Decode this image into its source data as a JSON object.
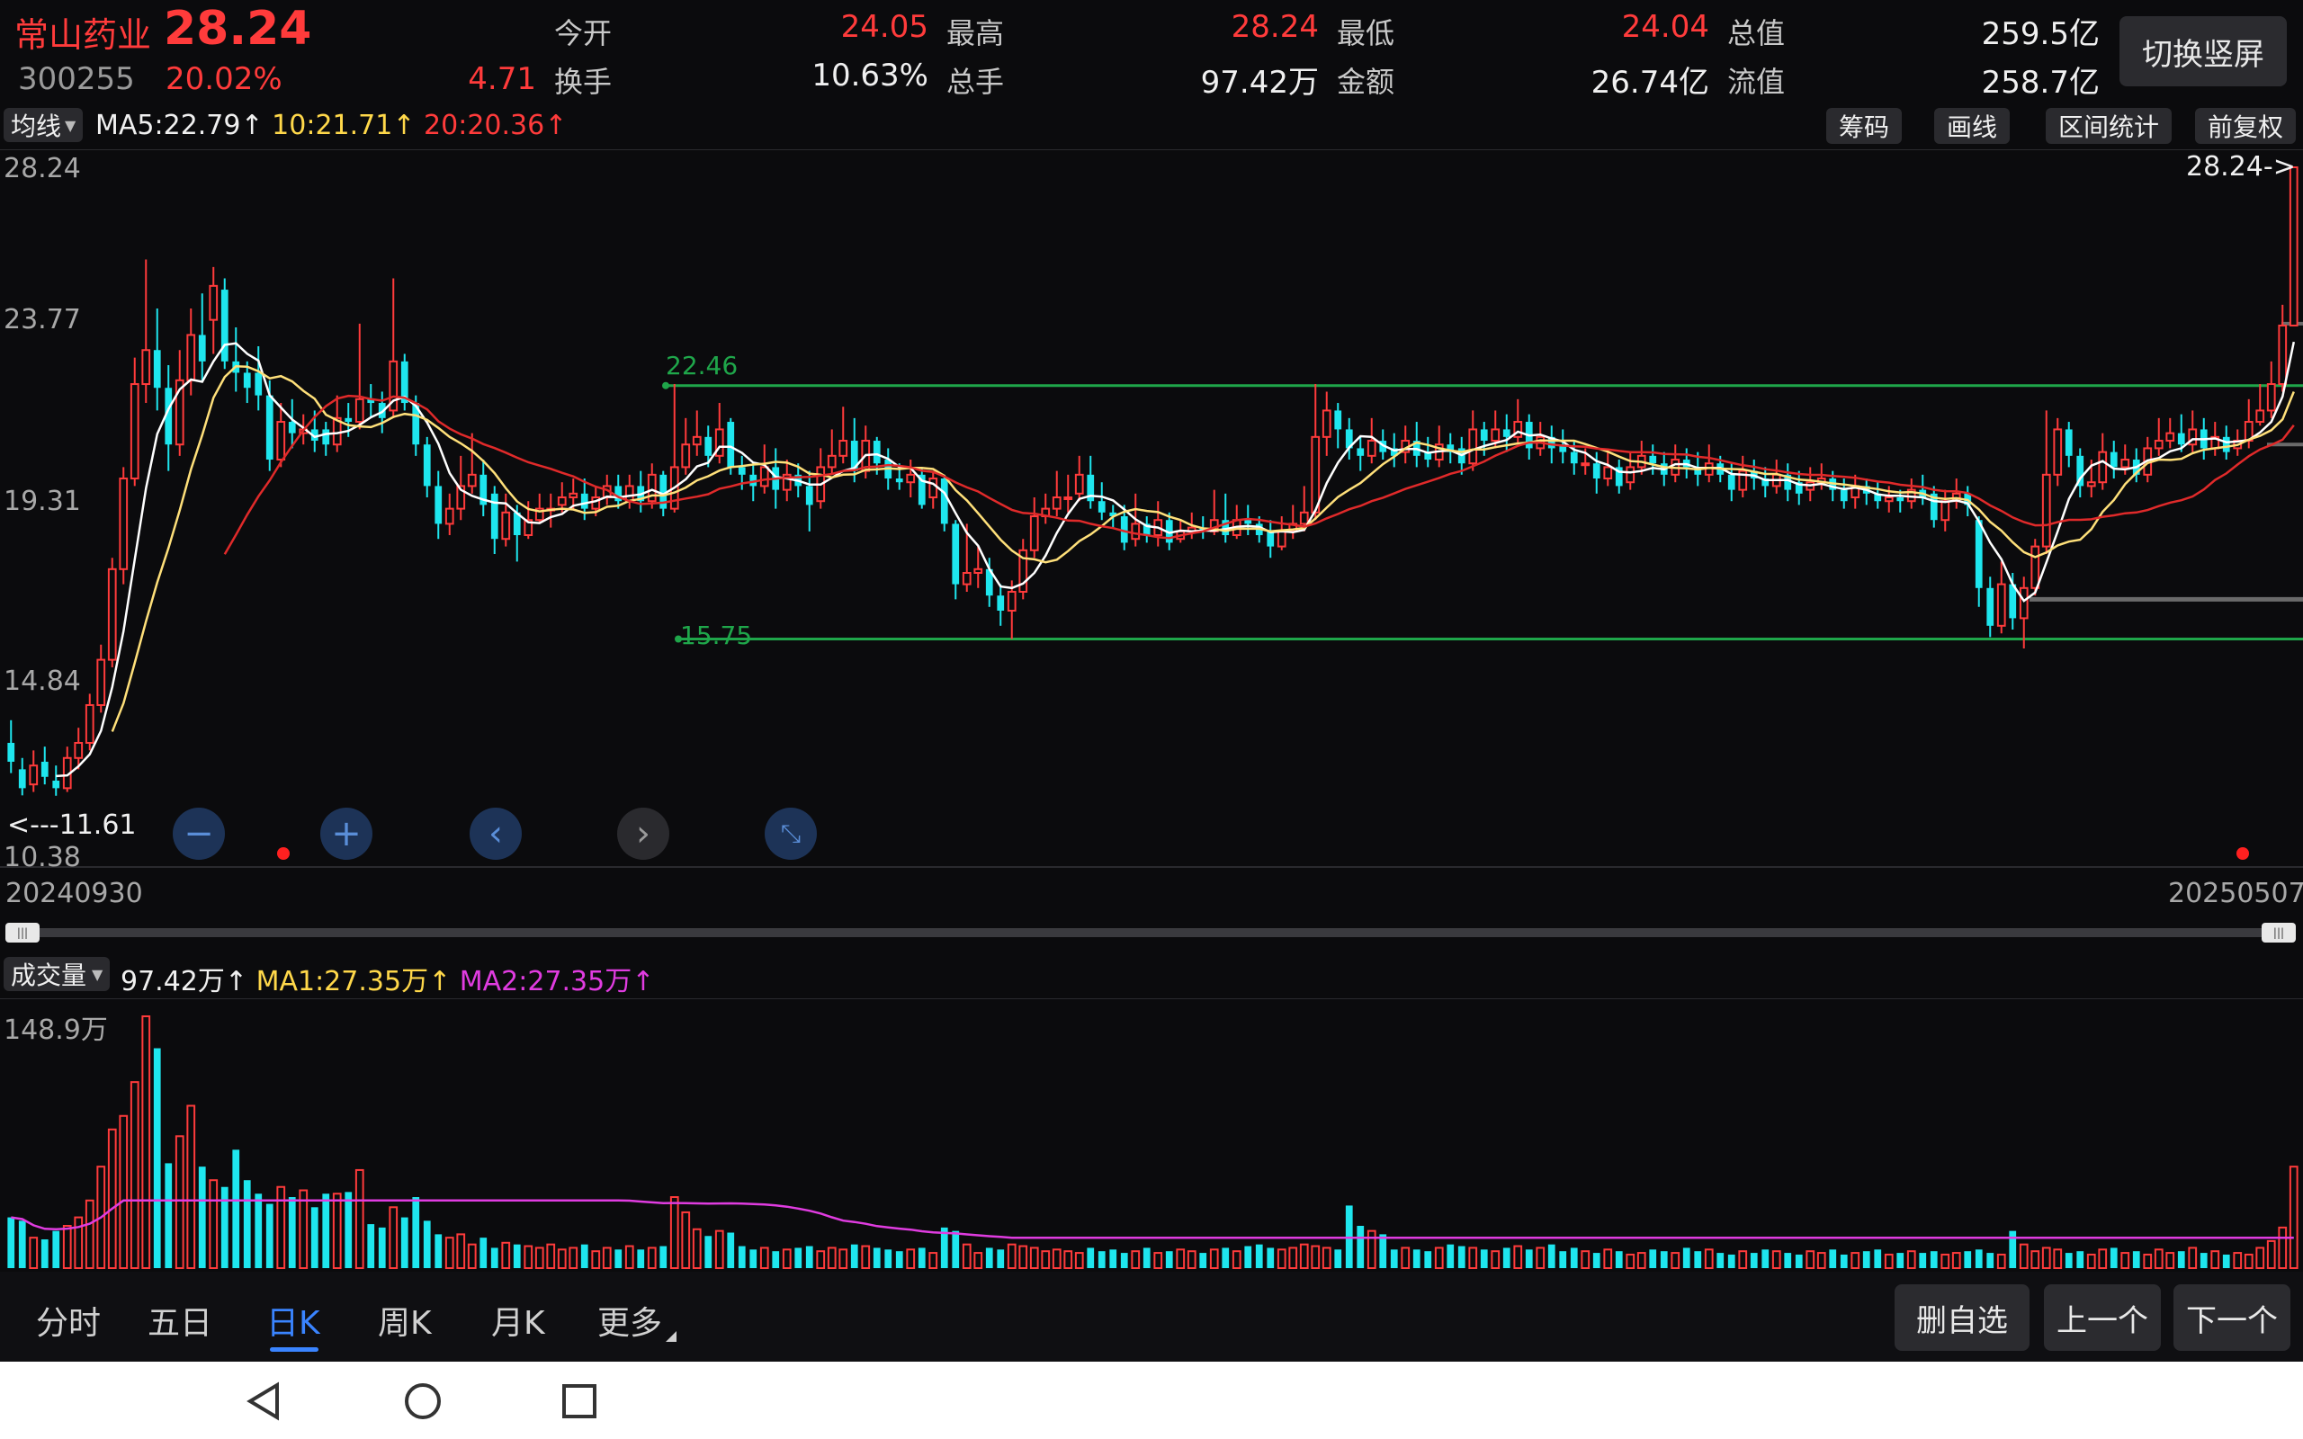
{
  "stock": {
    "name": "常山药业",
    "code": "300255",
    "price": "28.24",
    "change_pct": "20.02%",
    "change_abs": "4.71"
  },
  "quote": {
    "open_label": "今开",
    "open": "24.05",
    "high_label": "最高",
    "high": "28.24",
    "low_label": "最低",
    "low": "24.04",
    "mcap_label": "总值",
    "mcap": "259.5亿",
    "turnover_label": "换手",
    "turnover": "10.63%",
    "vol_label": "总手",
    "vol": "97.42万",
    "amount_label": "金额",
    "amount": "26.74亿",
    "float_label": "流值",
    "float": "258.7亿"
  },
  "switch_button": "切换竖屏",
  "ma_bar": {
    "selector": "均线",
    "ma5": "MA5:22.79",
    "ma10": "10:21.71",
    "ma20": "20:20.36",
    "arrow": "↑"
  },
  "tools": [
    "筹码",
    "画线",
    "区间统计",
    "前复权"
  ],
  "price_axis": {
    "max_label": "28.24",
    "l1": "23.77",
    "l2": "19.31",
    "l3": "14.84",
    "min_label": "10.38",
    "right_marker": "28.24->",
    "left_marker": "<---11.61"
  },
  "lines": {
    "upper": "22.46",
    "lower": "15.75"
  },
  "dates": {
    "start": "20240930",
    "end": "20250507"
  },
  "volume_bar": {
    "selector": "成交量",
    "vol": "97.42万",
    "ma1": "MA1:27.35万",
    "ma2": "MA2:27.35万",
    "arrow": "↑",
    "max_label": "148.9万"
  },
  "tabs": [
    "分时",
    "五日",
    "日K",
    "周K",
    "月K",
    "更多"
  ],
  "active_tab": "日K",
  "actions": [
    "删自选",
    "上一个",
    "下一个"
  ],
  "colors": {
    "up": "#ff3b3b",
    "down": "#1ee6ee",
    "ma5": "#ffffff",
    "ma10": "#ffe07a",
    "ma20": "#e02a2a",
    "hline": "#1fa64a",
    "vol_ma2": "#e03ce0",
    "accent": "#3a84ff"
  },
  "chart_data": {
    "type": "candlestick",
    "ylim": [
      10.38,
      28.24
    ],
    "candles": [
      [
        13.0,
        12.5,
        13.6,
        12.2
      ],
      [
        12.3,
        11.8,
        12.6,
        11.61
      ],
      [
        11.9,
        12.4,
        12.8,
        11.7
      ],
      [
        12.5,
        12.1,
        12.9,
        11.9
      ],
      [
        12.0,
        11.8,
        12.4,
        11.6
      ],
      [
        11.8,
        12.6,
        12.9,
        11.7
      ],
      [
        12.6,
        13.0,
        13.4,
        12.3
      ],
      [
        13.0,
        14.0,
        14.3,
        12.8
      ],
      [
        14.0,
        15.2,
        15.6,
        13.8
      ],
      [
        15.2,
        17.6,
        17.9,
        15.0
      ],
      [
        17.6,
        20.0,
        20.3,
        17.2
      ],
      [
        20.0,
        22.5,
        23.2,
        19.8
      ],
      [
        22.5,
        23.4,
        25.8,
        22.0
      ],
      [
        23.4,
        22.4,
        24.5,
        21.8
      ],
      [
        22.4,
        20.9,
        23.0,
        20.2
      ],
      [
        20.9,
        22.6,
        23.4,
        20.6
      ],
      [
        22.6,
        23.8,
        24.5,
        22.2
      ],
      [
        23.8,
        23.1,
        24.9,
        22.6
      ],
      [
        24.2,
        25.1,
        25.6,
        23.3
      ],
      [
        25.0,
        23.1,
        25.3,
        22.9
      ],
      [
        23.1,
        22.8,
        24.0,
        22.3
      ],
      [
        22.8,
        22.4,
        23.1,
        22.0
      ],
      [
        22.8,
        22.2,
        23.5,
        21.8
      ],
      [
        22.2,
        20.5,
        22.6,
        20.2
      ],
      [
        20.5,
        21.5,
        22.0,
        20.3
      ],
      [
        21.5,
        21.2,
        22.1,
        20.8
      ],
      [
        21.2,
        21.3,
        21.7,
        20.9
      ],
      [
        21.3,
        21.0,
        21.8,
        20.7
      ],
      [
        21.3,
        20.9,
        21.5,
        20.6
      ],
      [
        20.9,
        21.6,
        22.2,
        20.7
      ],
      [
        21.6,
        21.5,
        22.0,
        21.1
      ],
      [
        21.5,
        22.1,
        24.1,
        21.3
      ],
      [
        22.1,
        22.0,
        22.5,
        21.6
      ],
      [
        22.0,
        21.6,
        22.3,
        21.2
      ],
      [
        21.8,
        23.1,
        25.3,
        21.6
      ],
      [
        23.1,
        22.0,
        23.3,
        21.8
      ],
      [
        22.0,
        20.9,
        22.2,
        20.6
      ],
      [
        20.9,
        19.8,
        21.1,
        19.5
      ],
      [
        19.8,
        18.8,
        20.2,
        18.4
      ],
      [
        18.8,
        19.2,
        19.6,
        18.5
      ],
      [
        19.2,
        19.8,
        20.6,
        18.9
      ],
      [
        19.8,
        20.1,
        21.2,
        19.6
      ],
      [
        20.1,
        19.3,
        20.5,
        19.0
      ],
      [
        19.6,
        18.4,
        19.8,
        18.0
      ],
      [
        18.4,
        19.1,
        19.6,
        18.2
      ],
      [
        19.1,
        18.5,
        19.3,
        17.8
      ],
      [
        18.5,
        18.9,
        19.4,
        18.4
      ],
      [
        18.9,
        19.2,
        19.6,
        18.8
      ],
      [
        19.2,
        19.2,
        19.6,
        18.7
      ],
      [
        19.3,
        19.5,
        19.9,
        19.1
      ],
      [
        19.5,
        19.6,
        20.0,
        19.2
      ],
      [
        19.6,
        19.2,
        20.0,
        18.9
      ],
      [
        19.2,
        19.5,
        19.8,
        19.0
      ],
      [
        19.5,
        19.8,
        20.1,
        19.3
      ],
      [
        19.8,
        19.4,
        20.1,
        19.2
      ],
      [
        19.4,
        19.8,
        20.1,
        19.2
      ],
      [
        19.8,
        19.4,
        20.2,
        19.1
      ],
      [
        19.4,
        20.1,
        20.4,
        19.2
      ],
      [
        20.1,
        19.2,
        20.2,
        19.0
      ],
      [
        19.2,
        20.3,
        22.5,
        19.1
      ],
      [
        20.3,
        20.9,
        21.6,
        20.1
      ],
      [
        20.9,
        21.1,
        21.8,
        20.6
      ],
      [
        21.1,
        20.6,
        21.4,
        20.3
      ],
      [
        20.6,
        21.3,
        22.0,
        20.4
      ],
      [
        21.5,
        20.3,
        21.6,
        20.1
      ],
      [
        20.3,
        20.1,
        20.6,
        19.7
      ],
      [
        20.1,
        19.8,
        20.4,
        19.4
      ],
      [
        19.8,
        20.3,
        20.9,
        19.6
      ],
      [
        20.3,
        19.7,
        20.8,
        19.2
      ],
      [
        19.7,
        20.1,
        20.5,
        19.4
      ],
      [
        20.1,
        19.8,
        20.4,
        19.5
      ],
      [
        19.8,
        19.3,
        20.2,
        18.6
      ],
      [
        19.4,
        20.3,
        20.8,
        19.2
      ],
      [
        20.3,
        20.6,
        21.3,
        20.1
      ],
      [
        20.6,
        21.0,
        21.9,
        20.4
      ],
      [
        21.0,
        20.2,
        21.6,
        19.9
      ],
      [
        20.2,
        21.0,
        21.4,
        20.0
      ],
      [
        21.0,
        20.4,
        21.1,
        20.1
      ],
      [
        20.5,
        20.0,
        20.8,
        19.7
      ],
      [
        20.0,
        19.9,
        20.4,
        19.7
      ],
      [
        19.9,
        20.1,
        20.5,
        19.5
      ],
      [
        20.1,
        19.3,
        20.3,
        19.2
      ],
      [
        19.5,
        20.0,
        20.2,
        19.2
      ],
      [
        20.0,
        18.8,
        20.1,
        18.6
      ],
      [
        18.8,
        17.2,
        18.9,
        16.8
      ],
      [
        17.2,
        17.5,
        18.8,
        17.0
      ],
      [
        17.5,
        17.6,
        18.2,
        17.1
      ],
      [
        17.6,
        16.9,
        17.9,
        16.6
      ],
      [
        16.9,
        16.5,
        17.2,
        16.1
      ],
      [
        16.5,
        17.0,
        17.3,
        15.75
      ],
      [
        17.0,
        18.1,
        18.4,
        16.8
      ],
      [
        18.1,
        19.0,
        19.5,
        17.9
      ],
      [
        19.0,
        19.2,
        19.6,
        18.8
      ],
      [
        19.2,
        19.5,
        20.2,
        19.0
      ],
      [
        19.5,
        19.5,
        20.1,
        19.1
      ],
      [
        19.6,
        20.1,
        20.6,
        19.4
      ],
      [
        20.1,
        19.4,
        20.6,
        19.2
      ],
      [
        19.4,
        19.1,
        19.9,
        18.9
      ],
      [
        19.1,
        19.0,
        19.3,
        18.7
      ],
      [
        19.0,
        18.3,
        19.3,
        18.1
      ],
      [
        18.4,
        18.8,
        19.6,
        18.2
      ],
      [
        18.8,
        18.5,
        19.0,
        18.3
      ],
      [
        18.5,
        18.9,
        19.4,
        18.2
      ],
      [
        18.9,
        18.3,
        19.1,
        18.1
      ],
      [
        18.4,
        18.6,
        18.9,
        18.3
      ],
      [
        18.6,
        18.7,
        19.1,
        18.4
      ],
      [
        18.7,
        18.6,
        19.0,
        18.4
      ],
      [
        18.6,
        18.9,
        19.7,
        18.5
      ],
      [
        18.9,
        18.5,
        19.6,
        18.3
      ],
      [
        18.5,
        18.9,
        19.3,
        18.4
      ],
      [
        18.9,
        18.8,
        19.3,
        18.5
      ],
      [
        18.8,
        18.5,
        19.0,
        18.3
      ],
      [
        18.6,
        18.2,
        18.9,
        17.9
      ],
      [
        18.2,
        18.6,
        19.0,
        18.1
      ],
      [
        18.6,
        18.8,
        19.3,
        18.4
      ],
      [
        18.8,
        19.1,
        19.8,
        18.6
      ],
      [
        19.1,
        21.1,
        22.5,
        18.9
      ],
      [
        21.1,
        21.8,
        22.3,
        20.6
      ],
      [
        21.8,
        21.3,
        22.0,
        20.8
      ],
      [
        21.3,
        20.8,
        21.6,
        20.5
      ],
      [
        20.8,
        20.6,
        21.1,
        20.2
      ],
      [
        20.6,
        21.0,
        21.6,
        20.4
      ],
      [
        21.0,
        20.7,
        21.3,
        20.5
      ],
      [
        20.8,
        20.6,
        21.2,
        20.3
      ],
      [
        20.7,
        21.0,
        21.4,
        20.4
      ],
      [
        21.0,
        20.6,
        21.5,
        20.3
      ],
      [
        20.7,
        20.5,
        21.1,
        20.3
      ],
      [
        20.5,
        20.9,
        21.4,
        20.3
      ],
      [
        20.9,
        20.7,
        21.2,
        20.4
      ],
      [
        20.8,
        20.4,
        21.1,
        20.1
      ],
      [
        20.4,
        21.3,
        21.8,
        20.2
      ],
      [
        21.3,
        21.0,
        21.5,
        20.6
      ],
      [
        21.0,
        21.3,
        21.8,
        20.8
      ],
      [
        21.3,
        21.1,
        21.7,
        20.7
      ],
      [
        21.1,
        21.5,
        22.1,
        20.9
      ],
      [
        21.5,
        20.8,
        21.7,
        20.5
      ],
      [
        20.8,
        21.1,
        21.5,
        20.6
      ],
      [
        21.1,
        20.8,
        21.4,
        20.4
      ],
      [
        20.9,
        20.7,
        21.3,
        20.4
      ],
      [
        20.7,
        20.4,
        21.0,
        20.1
      ],
      [
        20.4,
        20.4,
        20.8,
        20.1
      ],
      [
        20.4,
        20.0,
        20.7,
        19.6
      ],
      [
        20.0,
        20.3,
        20.7,
        19.8
      ],
      [
        20.3,
        19.8,
        20.5,
        19.6
      ],
      [
        19.9,
        20.3,
        20.7,
        19.7
      ],
      [
        20.3,
        20.6,
        21.0,
        20.1
      ],
      [
        20.6,
        20.4,
        20.9,
        20.1
      ],
      [
        20.4,
        20.1,
        20.7,
        19.8
      ],
      [
        20.1,
        20.5,
        20.9,
        19.9
      ],
      [
        20.5,
        20.3,
        20.8,
        20.0
      ],
      [
        20.3,
        20.1,
        20.7,
        19.8
      ],
      [
        20.1,
        20.4,
        20.9,
        19.9
      ],
      [
        20.4,
        20.1,
        20.6,
        19.9
      ],
      [
        20.1,
        19.7,
        20.4,
        19.4
      ],
      [
        19.7,
        20.2,
        20.6,
        19.5
      ],
      [
        20.2,
        20.0,
        20.5,
        19.7
      ],
      [
        20.0,
        19.8,
        20.3,
        19.5
      ],
      [
        19.8,
        20.1,
        20.5,
        19.6
      ],
      [
        20.1,
        19.7,
        20.4,
        19.4
      ],
      [
        19.9,
        19.6,
        20.2,
        19.3
      ],
      [
        19.7,
        19.9,
        20.3,
        19.4
      ],
      [
        19.9,
        20.0,
        20.4,
        19.7
      ],
      [
        20.0,
        19.7,
        20.2,
        19.4
      ],
      [
        19.7,
        19.4,
        20.0,
        19.2
      ],
      [
        19.5,
        19.8,
        20.1,
        19.2
      ],
      [
        19.8,
        19.6,
        20.0,
        19.3
      ],
      [
        19.6,
        19.4,
        19.9,
        19.2
      ],
      [
        19.4,
        19.5,
        19.8,
        19.1
      ],
      [
        19.5,
        19.4,
        19.7,
        19.1
      ],
      [
        19.4,
        19.7,
        20.0,
        19.2
      ],
      [
        19.7,
        19.5,
        20.1,
        19.3
      ],
      [
        19.6,
        18.9,
        19.8,
        18.7
      ],
      [
        18.9,
        19.4,
        19.7,
        18.6
      ],
      [
        19.4,
        19.6,
        20.0,
        19.2
      ],
      [
        19.6,
        19.3,
        19.8,
        19.0
      ],
      [
        18.9,
        17.1,
        19.0,
        16.6
      ],
      [
        17.1,
        16.1,
        17.4,
        15.8
      ],
      [
        16.1,
        17.2,
        17.8,
        15.9
      ],
      [
        17.2,
        16.3,
        17.5,
        16.0
      ],
      [
        16.3,
        17.1,
        17.4,
        15.5
      ],
      [
        17.1,
        18.2,
        18.4,
        16.9
      ],
      [
        18.2,
        20.1,
        21.8,
        18.0
      ],
      [
        20.1,
        21.3,
        21.6,
        19.8
      ],
      [
        21.3,
        20.6,
        21.5,
        20.3
      ],
      [
        20.6,
        19.8,
        20.8,
        19.5
      ],
      [
        19.8,
        19.9,
        20.5,
        19.5
      ],
      [
        19.9,
        20.7,
        21.2,
        19.7
      ],
      [
        20.7,
        20.3,
        21.0,
        20.0
      ],
      [
        20.3,
        20.5,
        20.9,
        20.1
      ],
      [
        20.5,
        20.1,
        20.8,
        19.9
      ],
      [
        20.1,
        20.8,
        21.1,
        19.9
      ],
      [
        20.8,
        21.0,
        21.6,
        20.6
      ],
      [
        21.0,
        21.2,
        21.6,
        20.8
      ],
      [
        21.2,
        20.9,
        21.7,
        20.7
      ],
      [
        20.9,
        21.3,
        21.8,
        20.7
      ],
      [
        21.3,
        20.8,
        21.6,
        20.5
      ],
      [
        20.8,
        21.1,
        21.5,
        20.6
      ],
      [
        21.1,
        20.7,
        21.4,
        20.5
      ],
      [
        20.8,
        21.0,
        21.3,
        20.6
      ],
      [
        21.0,
        21.5,
        22.1,
        20.8
      ],
      [
        21.5,
        21.8,
        22.5,
        21.4
      ],
      [
        21.8,
        22.5,
        23.1,
        21.6
      ],
      [
        22.5,
        24.05,
        24.6,
        22.3
      ],
      [
        24.05,
        28.24,
        28.24,
        24.04
      ]
    ],
    "volumes": [
      30,
      28,
      18,
      17,
      22,
      25,
      30,
      40,
      60,
      82,
      90,
      110,
      148.9,
      130,
      62,
      78,
      96,
      60,
      52,
      48,
      70,
      52,
      44,
      38,
      48,
      42,
      46,
      36,
      44,
      44,
      45,
      58,
      26,
      24,
      36,
      30,
      42,
      28,
      20,
      18,
      20,
      14,
      18,
      12,
      15,
      14,
      13,
      12,
      14,
      11,
      12,
      14,
      10,
      12,
      11,
      13,
      11,
      12,
      13,
      42,
      33,
      23,
      19,
      22,
      21,
      13,
      11,
      12,
      10,
      11,
      12,
      13,
      10,
      12,
      11,
      14,
      13,
      12,
      11,
      10,
      11,
      12,
      9,
      24,
      22,
      14,
      9,
      12,
      11,
      14,
      13,
      12,
      10,
      11,
      10,
      9,
      12,
      10,
      11,
      9,
      10,
      12,
      9,
      10,
      11,
      10,
      9,
      11,
      12,
      10,
      13,
      14,
      12,
      11,
      12,
      14,
      13,
      12,
      11,
      37,
      25,
      22,
      20,
      11,
      12,
      11,
      10,
      12,
      14,
      13,
      12,
      11,
      10,
      12,
      13,
      11,
      12,
      14,
      10,
      12,
      10,
      9,
      11,
      10,
      8,
      9,
      11,
      10,
      9,
      12,
      10,
      11,
      9,
      8,
      10,
      9,
      11,
      10,
      9,
      8,
      10,
      9,
      11,
      8,
      9,
      10,
      11,
      8,
      9,
      10,
      9,
      10,
      8,
      9,
      10,
      11,
      9,
      8,
      22,
      14,
      10,
      12,
      11,
      9,
      10,
      8,
      11,
      12,
      9,
      10,
      8,
      11,
      9,
      10,
      12,
      9,
      10,
      8,
      9,
      8,
      12,
      16,
      24,
      60
    ]
  }
}
